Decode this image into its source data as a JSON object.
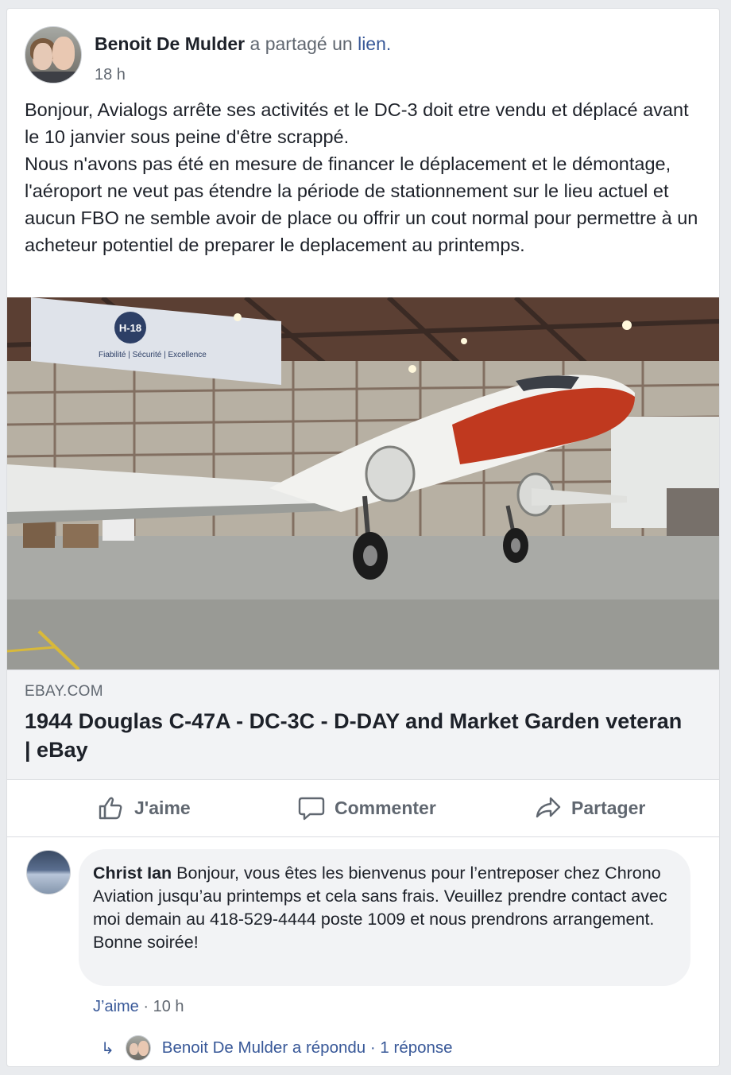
{
  "post": {
    "author": "Benoit De Mulder",
    "action_text": "a partagé un",
    "action_link": "lien.",
    "time": "18 h",
    "text_lines": [
      "Bonjour, Avialogs arrête ses activités et le DC-3 doit etre vendu et déplacé avant le 10 janvier sous peine d'être scrappé.",
      "Nous n'avons pas été en mesure de financer le déplacement et le démontage, l'aéroport ne veut pas étendre la période de stationnement sur le lieu actuel et aucun FBO ne semble avoir de place ou offrir un cout normal pour permettre à un acheteur potentiel de preparer le deplacement au printemps."
    ]
  },
  "photo": {
    "banner_badge": "H-18",
    "banner_text": "Fiabilité | Sécurité | Excellence"
  },
  "link_preview": {
    "domain": "EBAY.COM",
    "title": "1944 Douglas C-47A - DC-3C - D-DAY and Market Garden veteran | eBay"
  },
  "actions": {
    "like": "J'aime",
    "comment": "Commenter",
    "share": "Partager"
  },
  "comment": {
    "author": "Christ Ian",
    "text_line1": "Bonjour, vous êtes les bienvenus pour l’entreposer chez Chrono Aviation jusqu’au printemps et cela sans frais. Veuillez prendre contact avec moi demain au 418-529-4444 poste 1009 et nous prendrons arrangement.",
    "text_line2": "Bonne soirée!",
    "like_label": "J’aime",
    "separator": " · ",
    "time": "10 h"
  },
  "reply": {
    "text": "Benoit De Mulder a répondu · 1 réponse"
  },
  "colors": {
    "link_blue": "#385898",
    "secondary_text": "#606770",
    "primary_text": "#1d2129",
    "background": "#e9ebee",
    "plane_accent": "#c0391f"
  }
}
